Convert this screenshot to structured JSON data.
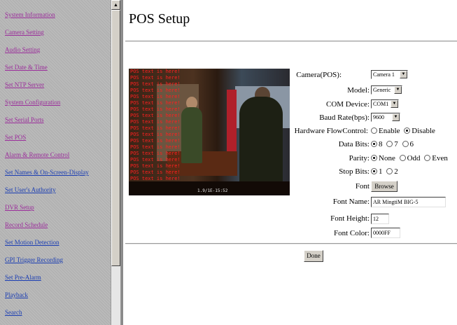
{
  "sidebar": {
    "items": [
      {
        "label": "System Information",
        "visited": true
      },
      {
        "label": "Camera Setting",
        "visited": true
      },
      {
        "label": "Audio Setting",
        "visited": true
      },
      {
        "label": "Set Date & Time",
        "visited": true
      },
      {
        "label": "Set NTP Server",
        "visited": true
      },
      {
        "label": "System Configuration",
        "visited": true
      },
      {
        "label": "Set Serial Ports",
        "visited": true
      },
      {
        "label": "Set POS",
        "visited": true
      },
      {
        "label": "Alarm & Remote Control",
        "visited": true
      },
      {
        "label": "Set Names & On-Screen-Display",
        "visited": false
      },
      {
        "label": "Set User's Authority",
        "visited": false
      },
      {
        "label": "DVR Setup",
        "visited": true
      },
      {
        "label": "Record Schedule",
        "visited": true
      },
      {
        "label": "Set Motion Detection",
        "visited": false
      },
      {
        "label": "GPI Trigger Recording",
        "visited": false
      },
      {
        "label": "Set Pre-Alarm",
        "visited": false
      },
      {
        "label": "Playback",
        "visited": false
      },
      {
        "label": "Search",
        "visited": false
      }
    ]
  },
  "page": {
    "title": "POS Setup"
  },
  "video": {
    "osd_lines": [
      "POS text is here!",
      "POS text is here!",
      "POS text is here!",
      "POS text is here!",
      "POS text is here!",
      "POS text is here!",
      "POS text is here!",
      "POS text is here!",
      "POS text is here!",
      "POS text is here!",
      "POS text is here!",
      "POS text is here!",
      "POS text is here!",
      "POS text is here!",
      "POS text is here!",
      "POS text is here!",
      "POS text is here!",
      "POS text is here!"
    ],
    "timestamp": "1.9/1E-15:52"
  },
  "form": {
    "camera": {
      "label": "Camera(POS):",
      "value": "Camera 1"
    },
    "model": {
      "label": "Model:",
      "value": "Generic"
    },
    "com_device": {
      "label": "COM Device:",
      "value": "COM1"
    },
    "baud_rate": {
      "label": "Baud Rate(bps):",
      "value": "9600"
    },
    "flow_control": {
      "label": "Hardware FlowControl:",
      "options": [
        "Enable",
        "Disable"
      ],
      "selected": "Disable"
    },
    "data_bits": {
      "label": "Data Bits:",
      "options": [
        "8",
        "7",
        "6"
      ],
      "selected": "8"
    },
    "parity": {
      "label": "Parity:",
      "options": [
        "None",
        "Odd",
        "Even"
      ],
      "selected": "None"
    },
    "stop_bits": {
      "label": "Stop Bits:",
      "options": [
        "1",
        "2"
      ],
      "selected": "1"
    },
    "font": {
      "label": "Font",
      "button": "Browse"
    },
    "font_name": {
      "label": "Font Name:",
      "value": "AR MingtiM BIG-5"
    },
    "font_height": {
      "label": "Font Height:",
      "value": "12"
    },
    "font_color": {
      "label": "Font Color:",
      "value": "0000FF"
    },
    "done_label": "Done"
  },
  "colors": {
    "visited_link": "#9b2d9b",
    "link": "#1a3db3",
    "osd_text": "#ff2020"
  }
}
